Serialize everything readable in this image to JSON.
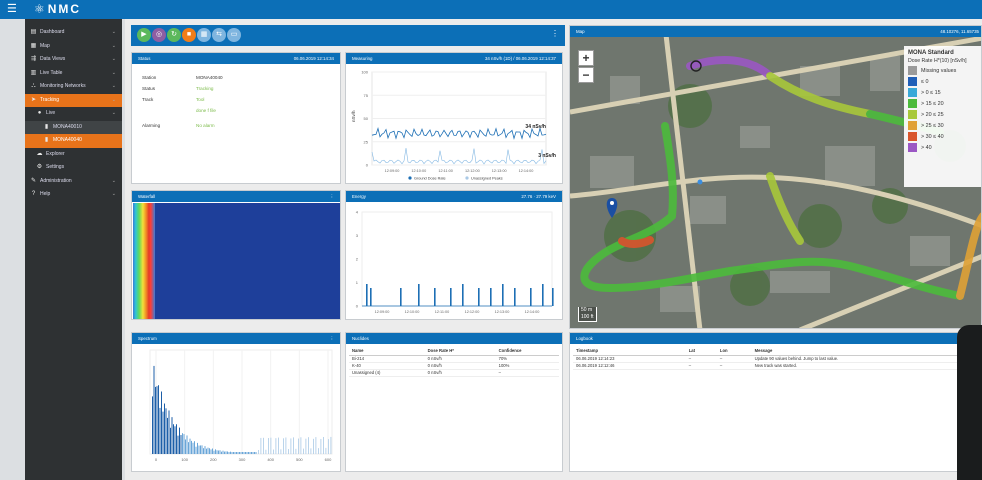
{
  "app": {
    "title": "NMC",
    "menu_icon": "hamburger-icon",
    "logo_icon": "radiation-icon"
  },
  "sidebar": {
    "items": [
      {
        "label": "Dashboard",
        "icon": "dashboard-icon",
        "chevron": true
      },
      {
        "label": "Map",
        "icon": "map-icon",
        "chevron": true
      },
      {
        "label": "Data Views",
        "icon": "data-views-icon",
        "chevron": true
      },
      {
        "label": "Live Table",
        "icon": "table-icon",
        "chevron": true
      },
      {
        "label": "Monitoring Networks",
        "icon": "network-icon",
        "chevron": true
      },
      {
        "label": "Tracking",
        "icon": "tracking-icon",
        "chevron": true,
        "selected": true
      },
      {
        "label": "Live",
        "icon": "live-icon",
        "chevron": true,
        "level": 1
      },
      {
        "label": "MONA40010",
        "icon": "device-icon",
        "level": 2
      },
      {
        "label": "MONA40040",
        "icon": "device-icon",
        "level": 2,
        "active": true
      },
      {
        "label": "Explorer",
        "icon": "explorer-icon",
        "level": 1
      },
      {
        "label": "Settings",
        "icon": "settings-icon",
        "level": 1
      },
      {
        "label": "Administration",
        "icon": "wrench-icon",
        "chevron": true
      },
      {
        "label": "Help",
        "icon": "help-icon",
        "chevron": true
      }
    ]
  },
  "toolbar": {
    "buttons": [
      {
        "name": "play-button",
        "color": "#5cb85c"
      },
      {
        "name": "record-button",
        "color": "#8e5ea2"
      },
      {
        "name": "refresh-button",
        "color": "#5cb85c"
      },
      {
        "name": "stop-button",
        "color": "#f07d1a"
      },
      {
        "name": "grid-button",
        "color": "#7fb5df"
      },
      {
        "name": "share-button",
        "color": "#7fb5df"
      },
      {
        "name": "monitor-button",
        "color": "#7fb5df"
      }
    ],
    "more": "⋮"
  },
  "status": {
    "title": "Status",
    "timestamp": "06.06.2019 12:14:34",
    "rows": [
      {
        "key": "Station",
        "value": "MONA40040",
        "green": false
      },
      {
        "key": "Status",
        "value": "Tracking",
        "green": true
      },
      {
        "key": "Track",
        "value": "Tool",
        "green": true
      },
      {
        "key": "",
        "value": "done f file",
        "green": true
      },
      {
        "key": "Alarming",
        "value": "No alarm",
        "green": true
      }
    ]
  },
  "measuring": {
    "title": "Measuring",
    "header_right": "34 nSv/h (1D) / 06.06.2019 12:14:37",
    "ylabel": "nSv/h",
    "label_a": "34 nSv/h",
    "label_b": "3 nSv/h",
    "legend_a": "Ground Dose Rate",
    "legend_b": "Unassigned Peaks",
    "yticks": [
      "100",
      "75",
      "50",
      "25",
      "0"
    ],
    "xticks": [
      "12:09:00",
      "12:10:00",
      "12:11:00",
      "12:12:00",
      "12:13:00",
      "12:14:00"
    ]
  },
  "waterfall": {
    "title": "Waterfall"
  },
  "energy": {
    "title": "Energy",
    "header_right": "27.76 · 27.79 keV",
    "yticks": [
      "4",
      "3",
      "2",
      "1",
      "0"
    ],
    "xticks": [
      "12:09:00",
      "12:10:00",
      "12:11:00",
      "12:12:00",
      "12:13:00",
      "12:14:00"
    ]
  },
  "spectrum": {
    "title": "Spectrum",
    "xticks": [
      "0",
      "100",
      "200",
      "300",
      "400",
      "500",
      "600"
    ]
  },
  "nuclides": {
    "title": "Nuclides",
    "columns": [
      "Name",
      "Dose Rate H*",
      "Confidence"
    ],
    "rows": [
      [
        "Bi-214",
        "0 nSv/h",
        "70%"
      ],
      [
        "K-40",
        "0 nSv/h",
        "100%"
      ],
      [
        "Unassigned (4)",
        "0 nSv/h",
        "–"
      ]
    ]
  },
  "logbook": {
    "title": "Logbook",
    "columns": [
      "Timestamp",
      "Lat",
      "Lon",
      "Message"
    ],
    "rows": [
      [
        "06.06.2019 12:14:23",
        "–",
        "–",
        "Update 90 values behind. Jump to last value."
      ],
      [
        "06.06.2019 12:12:46",
        "–",
        "–",
        "New track was started."
      ]
    ]
  },
  "map": {
    "title": "Map",
    "coords": "48.10276, 11.65735",
    "zoom_in": "+",
    "zoom_out": "−",
    "scale_a": "50 m",
    "scale_b": "100 ft",
    "legend": {
      "title": "MONA Standard",
      "subtitle": "Dose Rate H*(10) [nSv/h]",
      "rows": [
        {
          "label": "Missing values",
          "color": "#9a9a9a"
        },
        {
          "label": "≤ 0",
          "color": "#1f5fb8"
        },
        {
          "label": "> 0 ≤ 15",
          "color": "#39a9d8"
        },
        {
          "label": "> 15 ≤ 20",
          "color": "#4cbb3c"
        },
        {
          "label": "> 20 ≤ 25",
          "color": "#a8c83a"
        },
        {
          "label": "> 25 ≤ 30",
          "color": "#e0a236"
        },
        {
          "label": "> 30 ≤ 40",
          "color": "#d9552d"
        },
        {
          "label": "> 40",
          "color": "#9b57c4"
        }
      ]
    }
  }
}
